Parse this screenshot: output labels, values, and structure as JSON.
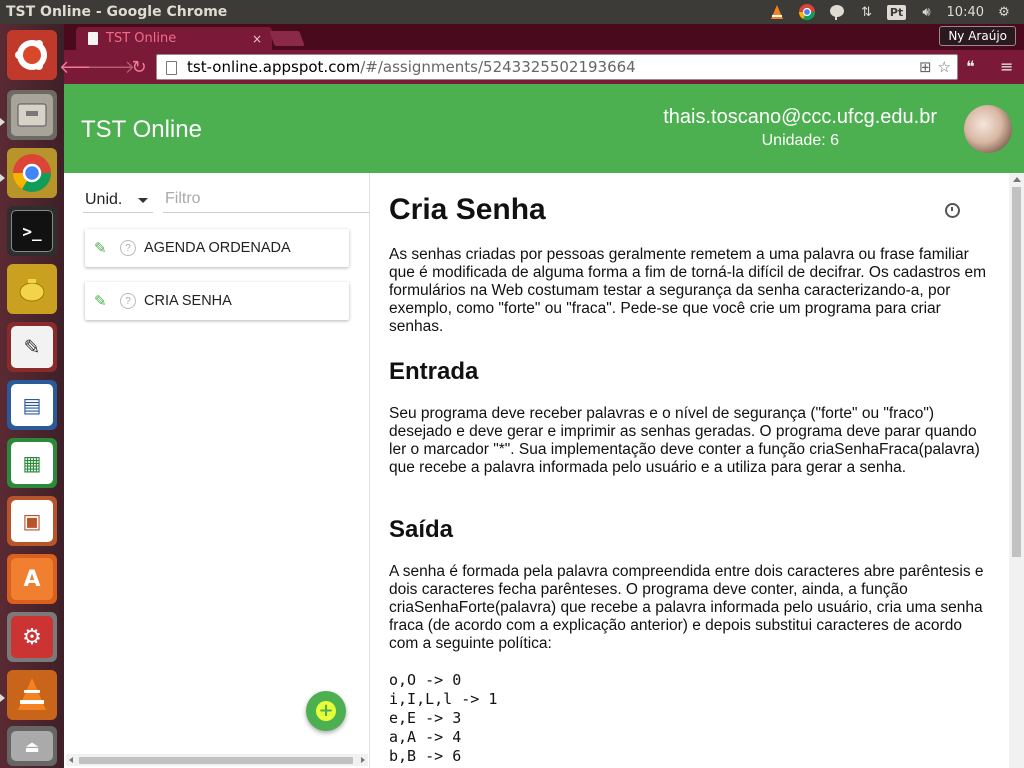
{
  "system": {
    "window_title": "TST Online - Google Chrome",
    "clock": "10:40",
    "pt_label": "Pt"
  },
  "browser": {
    "tab_title": "TST Online",
    "tab_close": "×",
    "profile_name": "Ny Araújo",
    "url_host": "tst-online.appspot.com",
    "url_path": "/#/assignments/5243325502193664"
  },
  "app": {
    "title": "TST Online",
    "user_email": "thais.toscano@ccc.ufcg.edu.br",
    "user_unit": "Unidade: 6"
  },
  "sidebar": {
    "unit_select_value": "Unid.",
    "filter_placeholder": "Filtro",
    "assignments": [
      {
        "status": "?",
        "title": "AGENDA ORDENADA"
      },
      {
        "status": "?",
        "title": "CRIA SENHA"
      }
    ],
    "fab_label": "+"
  },
  "content": {
    "title": "Cria Senha",
    "intro": "As senhas criadas por pessoas geralmente remetem a uma palavra ou frase familiar que é modificada de alguma forma a fim de torná-la difícil de decifrar. Os cadastros em formulários na Web costumam testar a segurança da senha caracterizando-a, por exemplo, como \"forte\" ou \"fraca\". Pede-se que você crie um programa para criar senhas.",
    "input_heading": "Entrada",
    "input_text": "Seu programa deve receber palavras e o nível de segurança (\"forte\" ou \"fraco\") desejado e deve gerar e imprimir as senhas geradas. O programa deve parar quando ler o marcador \"*\". Sua implementação deve conter a função criaSenhaFraca(palavra) que recebe a palavra informada pelo usuário e a utiliza para gerar a senha.",
    "output_heading": "Saída",
    "output_text": "A senha é formada pela palavra compreendida entre dois caracteres abre parêntesis e dois caracteres fecha parênteses. O programa deve conter, ainda, a função criaSenhaForte(palavra) que recebe a palavra informada pelo usuário, cria uma senha fraca (de acordo com a explicação anterior) e depois substitui caracteres de acordo com a seguinte política:",
    "code_block": "o,O -> 0\ni,I,L,l -> 1\ne,E -> 3\na,A -> 4\nb,B -> 6"
  }
}
